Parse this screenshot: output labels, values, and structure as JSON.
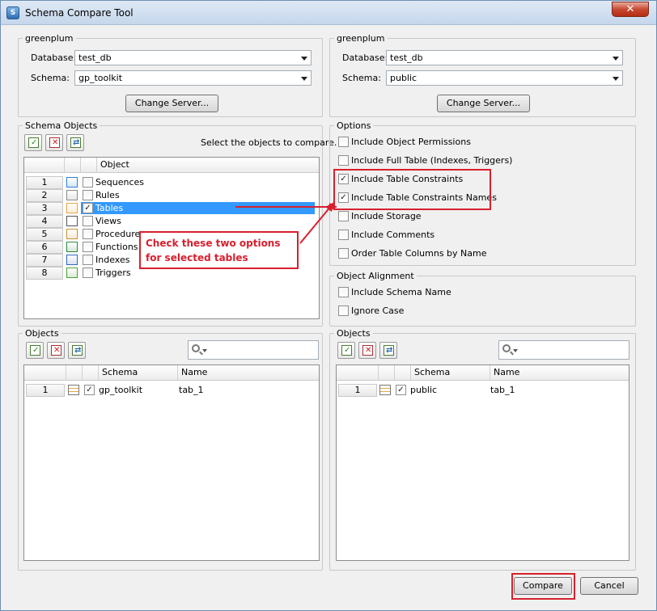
{
  "window": {
    "title": "Schema Compare Tool",
    "close_symbol": "✕"
  },
  "left_server": {
    "legend": "greenplum",
    "database_label": "Database:",
    "database_value": "test_db",
    "schema_label": "Schema:",
    "schema_value": "gp_toolkit",
    "change_server": "Change Server..."
  },
  "right_server": {
    "legend": "greenplum",
    "database_label": "Database:",
    "database_value": "test_db",
    "schema_label": "Schema:",
    "schema_value": "public",
    "change_server": "Change Server..."
  },
  "schema_objects": {
    "legend": "Schema Objects",
    "hint": "Select the objects to compare.",
    "column_header": "Object",
    "rows": [
      {
        "num": "1",
        "name": "Sequences",
        "checked": false,
        "selected": false
      },
      {
        "num": "2",
        "name": "Rules",
        "checked": false,
        "selected": false
      },
      {
        "num": "3",
        "name": "Tables",
        "checked": true,
        "selected": true
      },
      {
        "num": "4",
        "name": "Views",
        "checked": false,
        "selected": false
      },
      {
        "num": "5",
        "name": "Procedures",
        "checked": false,
        "selected": false
      },
      {
        "num": "6",
        "name": "Functions",
        "checked": false,
        "selected": false
      },
      {
        "num": "7",
        "name": "Indexes",
        "checked": false,
        "selected": false
      },
      {
        "num": "8",
        "name": "Triggers",
        "checked": false,
        "selected": false
      }
    ]
  },
  "options": {
    "legend": "Options",
    "items": [
      {
        "label": "Include Object Permissions",
        "checked": false
      },
      {
        "label": "Include Full Table (Indexes, Triggers)",
        "checked": false
      },
      {
        "label": "Include Table Constraints",
        "checked": true
      },
      {
        "label": "Include Table Constraints Names",
        "checked": true
      },
      {
        "label": "Include Storage",
        "checked": false
      },
      {
        "label": "Include Comments",
        "checked": false
      },
      {
        "label": "Order Table Columns by Name",
        "checked": false
      }
    ]
  },
  "object_alignment": {
    "legend": "Object Alignment",
    "items": [
      {
        "label": "Include Schema Name",
        "checked": false
      },
      {
        "label": "Ignore Case",
        "checked": false
      }
    ]
  },
  "annotation": {
    "text": "Check these two options for selected tables"
  },
  "left_objects": {
    "legend": "Objects",
    "columns": [
      "Schema",
      "Name"
    ],
    "rows": [
      {
        "num": "1",
        "checked": true,
        "schema": "gp_toolkit",
        "name": "tab_1"
      }
    ]
  },
  "right_objects": {
    "legend": "Objects",
    "columns": [
      "Schema",
      "Name"
    ],
    "rows": [
      {
        "num": "1",
        "checked": true,
        "schema": "public",
        "name": "tab_1"
      }
    ]
  },
  "buttons": {
    "compare": "Compare",
    "cancel": "Cancel"
  },
  "colors": {
    "selection": "#3399ff",
    "highlight": "#d8202f"
  }
}
